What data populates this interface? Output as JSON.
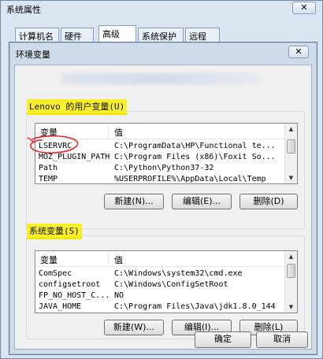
{
  "outer_window": {
    "title": "系统属性",
    "close": "✕",
    "tabs": [
      "计算机名",
      "硬件",
      "高级",
      "系统保护",
      "远程"
    ]
  },
  "dialog": {
    "title": "环境变量",
    "close": "✕"
  },
  "user_vars": {
    "label": "Lenovo 的用户变量(U)",
    "headers": [
      "变量",
      "值"
    ],
    "rows": [
      {
        "name": "LSERVRC",
        "value": "C:\\ProgramData\\HP\\Functional te..."
      },
      {
        "name": "MOZ_PLUGIN_PATH",
        "value": "C:\\Program Files (x86)\\Foxit So..."
      },
      {
        "name": "Path",
        "value": "C:\\Python\\Python37-32"
      },
      {
        "name": "TEMP",
        "value": "%USERPROFILE%\\AppData\\Local\\Temp"
      }
    ],
    "buttons": {
      "new": "新建(N)...",
      "edit": "编辑(E)...",
      "delete": "删除(D)"
    }
  },
  "system_vars": {
    "label": "系统变量(S)",
    "headers": [
      "变量",
      "值"
    ],
    "rows": [
      {
        "name": "ComSpec",
        "value": "C:\\Windows\\system32\\cmd.exe"
      },
      {
        "name": "configsetroot",
        "value": "C:\\Windows\\ConfigSetRoot"
      },
      {
        "name": "FP_NO_HOST_C...",
        "value": "NO"
      },
      {
        "name": "JAVA_HOME",
        "value": "C:\\Program Files\\Java\\jdk1.8.0_144"
      }
    ],
    "buttons": {
      "new": "新建(W)...",
      "edit": "编辑(I)...",
      "delete": "删除(L)"
    }
  },
  "footer": {
    "ok": "确定",
    "cancel": "取消"
  },
  "colors": {
    "highlight": "#f8ef2a",
    "annotation": "#e8262b"
  }
}
